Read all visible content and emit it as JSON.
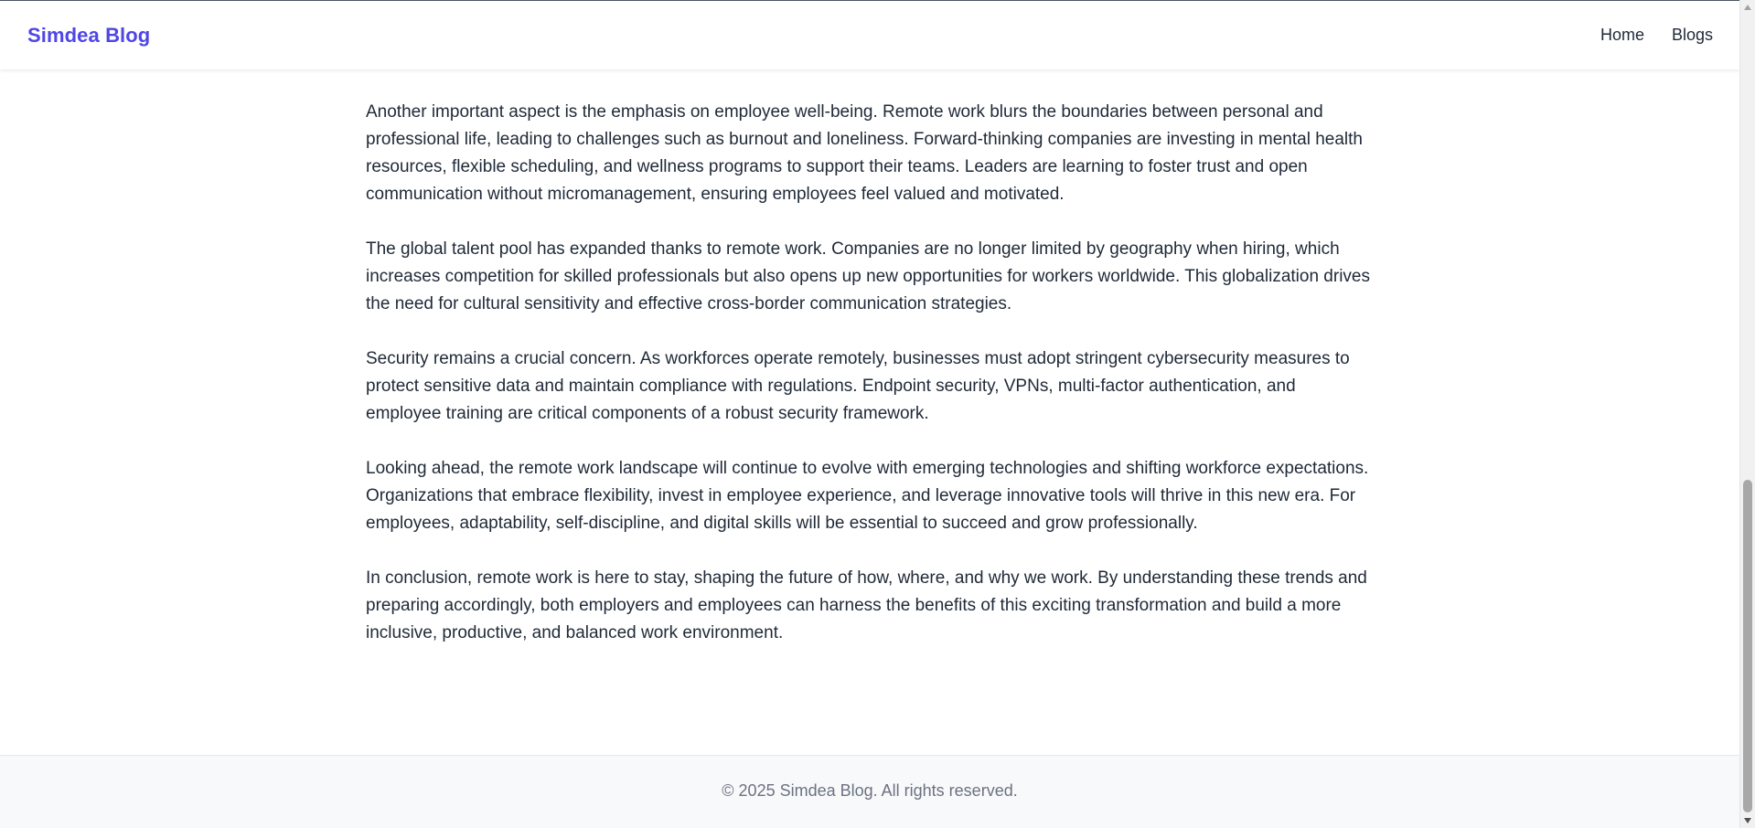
{
  "header": {
    "brand": "Simdea Blog",
    "nav": [
      {
        "label": "Home"
      },
      {
        "label": "Blogs"
      }
    ]
  },
  "article": {
    "paragraphs": [
      "Another important aspect is the emphasis on employee well-being. Remote work blurs the boundaries between personal and professional life, leading to challenges such as burnout and loneliness. Forward-thinking companies are investing in mental health resources, flexible scheduling, and wellness programs to support their teams. Leaders are learning to foster trust and open communication without micromanagement, ensuring employees feel valued and motivated.",
      "The global talent pool has expanded thanks to remote work. Companies are no longer limited by geography when hiring, which increases competition for skilled professionals but also opens up new opportunities for workers worldwide. This globalization drives the need for cultural sensitivity and effective cross-border communication strategies.",
      "Security remains a crucial concern. As workforces operate remotely, businesses must adopt stringent cybersecurity measures to protect sensitive data and maintain compliance with regulations. Endpoint security, VPNs, multi-factor authentication, and employee training are critical components of a robust security framework.",
      "Looking ahead, the remote work landscape will continue to evolve with emerging technologies and shifting workforce expectations. Organizations that embrace flexibility, invest in employee experience, and leverage innovative tools will thrive in this new era. For employees, adaptability, self-discipline, and digital skills will be essential to succeed and grow professionally.",
      "In conclusion, remote work is here to stay, shaping the future of how, where, and why we work. By understanding these trends and preparing accordingly, both employers and employees can harness the benefits of this exciting transformation and build a more inclusive, productive, and balanced work environment."
    ]
  },
  "footer": {
    "text": "© 2025 Simdea Blog. All rights reserved."
  },
  "colors": {
    "brand": "#4f46e5",
    "text": "#1f2937",
    "muted": "#6b7280",
    "footer_bg": "#f8f9fb"
  }
}
